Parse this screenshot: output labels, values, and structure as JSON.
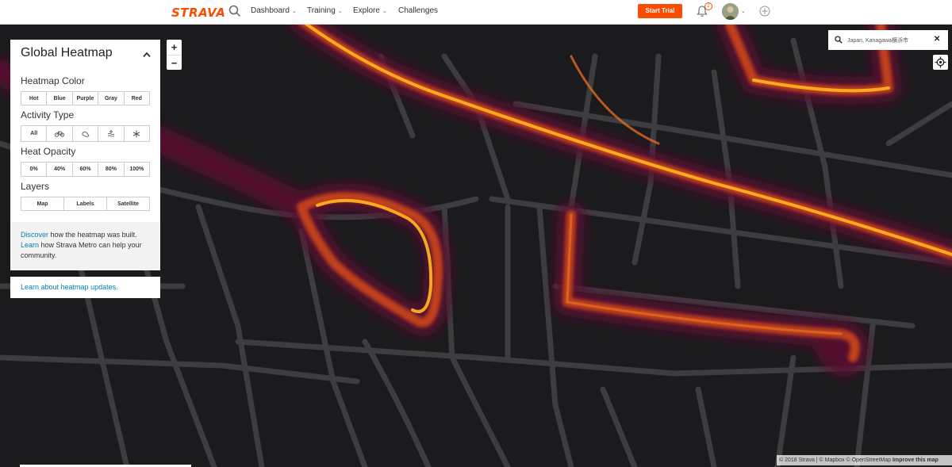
{
  "nav": {
    "logo": "STRAVA",
    "items": [
      {
        "label": "Dashboard",
        "has_menu": true
      },
      {
        "label": "Training",
        "has_menu": true
      },
      {
        "label": "Explore",
        "has_menu": true
      },
      {
        "label": "Challenges",
        "has_menu": false
      }
    ],
    "start_trial": "Start Trial",
    "notification_count": "2",
    "brand_color": "#fc4c02"
  },
  "panel": {
    "title": "Global Heatmap",
    "heatmap_color": {
      "title": "Heatmap Color",
      "options": [
        "Hot",
        "Blue",
        "Purple",
        "Gray",
        "Red"
      ],
      "selected": "Hot"
    },
    "activity_type": {
      "title": "Activity Type",
      "options": [
        "All",
        "bike-icon",
        "run-icon",
        "water-icon",
        "winter-icon"
      ],
      "selected": "All"
    },
    "heat_opacity": {
      "title": "Heat Opacity",
      "options": [
        "0%",
        "40%",
        "60%",
        "80%",
        "100%"
      ]
    },
    "layers": {
      "title": "Layers",
      "options": [
        "Map",
        "Labels",
        "Satellite"
      ]
    },
    "footer": {
      "discover_link": "Discover",
      "discover_text": " how the heatmap was built.",
      "learn_link": "Learn",
      "learn_text": " how Strava Metro can help your community."
    },
    "updates_link": "Learn about heatmap updates."
  },
  "zoom": {
    "in": "+",
    "out": "−"
  },
  "location_search": {
    "value": "Japan, Kanagawa横浜市",
    "clear": "✕"
  },
  "attribution": {
    "text": "© 2018 Strava | © Mapbox © OpenStreetMap ",
    "improve": "Improve this map"
  },
  "map_colors": {
    "background": "#1b1b1d",
    "road": "#3d3d40",
    "heat_outer": "#5a1030",
    "heat_mid": "#c0401a",
    "heat_core": "#ffb020"
  }
}
